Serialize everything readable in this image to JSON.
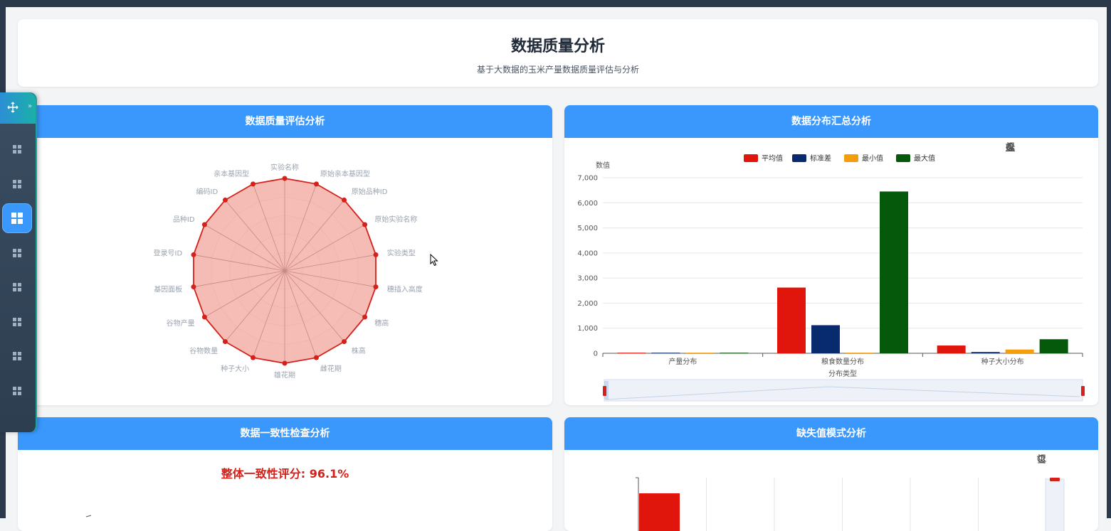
{
  "header": {
    "title": "数据质量分析",
    "subtitle": "基于大数据的玉米产量数据质量评估与分析"
  },
  "panels": {
    "quality": {
      "title": "数据质量评估分析"
    },
    "distribution": {
      "title": "数据分布汇总分析"
    },
    "consistency": {
      "title": "数据一致性检查分析",
      "score_label": "整体一致性评分: 96.1%"
    },
    "missing": {
      "title": "缺失值模式分析"
    }
  },
  "sidebar": {
    "items": 8,
    "active_index": 2
  },
  "chart_data": [
    {
      "type": "radar",
      "indicators": [
        "实验名称",
        "原始亲本基因型",
        "原始品种ID",
        "原始实验名称",
        "实验类型",
        "穗插入高度",
        "穗高",
        "株高",
        "雌花期",
        "雄花期",
        "种子大小",
        "谷物数量",
        "谷物产量",
        "基因面板",
        "登录号ID",
        "品种ID",
        "编码ID",
        "亲本基因型"
      ],
      "values": [
        100,
        100,
        100,
        100,
        100,
        100,
        100,
        100,
        100,
        100,
        100,
        100,
        100,
        100,
        100,
        100,
        100,
        100
      ],
      "max": 100,
      "fill_color": "#f4b1a9",
      "line_color": "#d6201a"
    },
    {
      "type": "bar",
      "categories": [
        "产量分布",
        "粮食数量分布",
        "种子大小分布"
      ],
      "series": [
        {
          "name": "平均值",
          "color": "#e0150b",
          "values": [
            5,
            2620,
            310
          ]
        },
        {
          "name": "标准差",
          "color": "#082a6e",
          "values": [
            3,
            1120,
            50
          ]
        },
        {
          "name": "最小值",
          "color": "#f59e0b",
          "values": [
            1,
            0,
            150
          ]
        },
        {
          "name": "最大值",
          "color": "#05590a",
          "values": [
            20,
            6450,
            560
          ]
        }
      ],
      "ylabel": "数值",
      "xlabel": "分布类型",
      "ylim": [
        0,
        7000
      ],
      "yticks": [
        "0",
        "1,000",
        "2,000",
        "3,000",
        "4,000",
        "5,000",
        "6,000",
        "7,000"
      ],
      "legend": "top-center"
    },
    {
      "type": "bar",
      "partial": true,
      "series": [
        {
          "color": "#e0150b"
        }
      ]
    }
  ],
  "icons": {
    "toolbox_distribution": [
      "crop-icon",
      "crop-back-icon",
      "restore-icon",
      "download-icon",
      "line-chart-icon",
      "bar-chart-icon"
    ],
    "toolbox_missing": [
      "crop-icon",
      "crop-back-icon",
      "restore-icon",
      "download-icon"
    ]
  }
}
